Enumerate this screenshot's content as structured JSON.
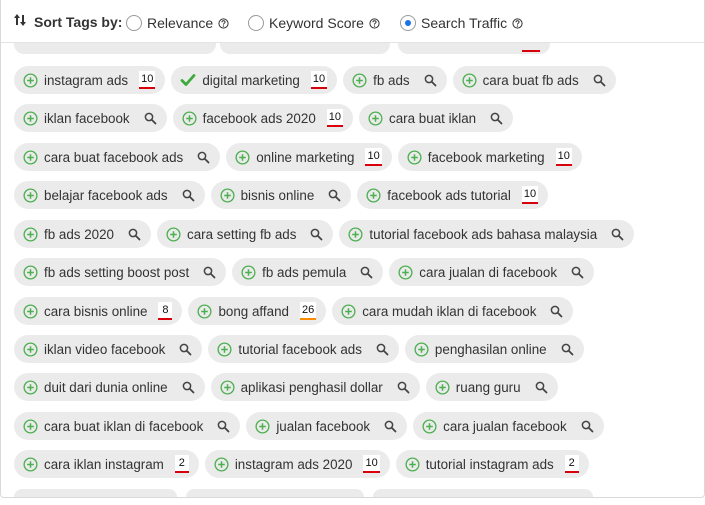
{
  "sort": {
    "label": "Sort Tags by:",
    "icon": "sort-arrows-icon",
    "options": [
      {
        "label": "Relevance",
        "checked": false
      },
      {
        "label": "Keyword Score",
        "checked": false
      },
      {
        "label": "Search Traffic",
        "checked": true
      }
    ]
  },
  "colors": {
    "add": "#4caf50",
    "check": "#3daa3d",
    "score_underline": "#d8000c",
    "score_underline_alt": "#ff8c00",
    "radio_selected": "#1a73e8"
  },
  "rows": [
    [
      {
        "text": "instagram ads",
        "score": "10"
      },
      {
        "text": "digital marketing",
        "score": "10",
        "added": true
      },
      {
        "text": "fb ads"
      },
      {
        "text": "cara buat fb ads"
      }
    ],
    [
      {
        "text": "iklan facebook"
      },
      {
        "text": "facebook ads 2020",
        "score": "10"
      },
      {
        "text": "cara buat iklan"
      }
    ],
    [
      {
        "text": "cara buat facebook ads"
      },
      {
        "text": "online marketing",
        "score": "10"
      },
      {
        "text": "facebook marketing",
        "score": "10"
      }
    ],
    [
      {
        "text": "belajar facebook ads"
      },
      {
        "text": "bisnis online"
      },
      {
        "text": "facebook ads tutorial",
        "score": "10"
      }
    ],
    [
      {
        "text": "fb ads 2020"
      },
      {
        "text": "cara setting fb ads"
      },
      {
        "text": "tutorial facebook ads bahasa malaysia"
      }
    ],
    [
      {
        "text": "fb ads setting boost post"
      },
      {
        "text": "fb ads pemula"
      },
      {
        "text": "cara jualan di facebook"
      }
    ],
    [
      {
        "text": "cara bisnis online",
        "score": "8"
      },
      {
        "text": "bong affand",
        "score": "26",
        "score_color": "orange"
      },
      {
        "text": "cara mudah iklan di facebook"
      }
    ],
    [
      {
        "text": "iklan video facebook"
      },
      {
        "text": "tutorial facebook ads"
      },
      {
        "text": "penghasilan online"
      }
    ],
    [
      {
        "text": "duit dari dunia online"
      },
      {
        "text": "aplikasi penghasil dollar"
      },
      {
        "text": "ruang guru"
      }
    ],
    [
      {
        "text": "cara buat iklan di facebook"
      },
      {
        "text": "jualan facebook"
      },
      {
        "text": "cara jualan facebook"
      }
    ],
    [
      {
        "text": "cara iklan instagram",
        "score": "2"
      },
      {
        "text": "instagram ads 2020",
        "score": "10"
      },
      {
        "text": "tutorial instagram ads",
        "score": "2"
      }
    ]
  ]
}
